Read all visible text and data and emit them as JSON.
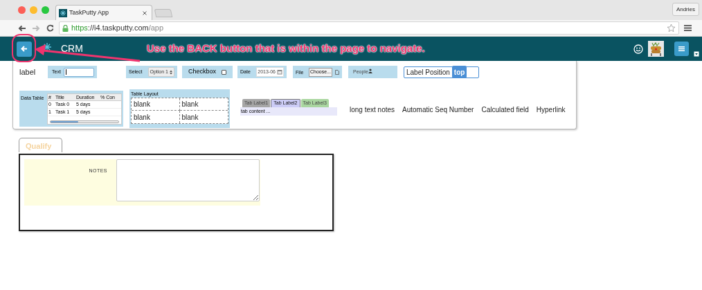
{
  "browser": {
    "tab_title": "TaskPutty App",
    "profile": "Andries",
    "url": {
      "scheme": "https",
      "host": "://i4.taskputty.com",
      "path": "/app"
    }
  },
  "header": {
    "title": "CRM"
  },
  "annotation": {
    "text": "Use the BACK button that is within the page to navigate."
  },
  "widgets": [
    {
      "kind": "label",
      "label": "label"
    },
    {
      "kind": "text",
      "label": "Text"
    },
    {
      "kind": "select",
      "label": "Select",
      "value": "Option 1"
    },
    {
      "kind": "checkbox",
      "label": "Checkbox",
      "checked": false
    },
    {
      "kind": "date",
      "label": "Date",
      "value": "2013-06"
    },
    {
      "kind": "file",
      "label": "File",
      "value": "Choose..."
    },
    {
      "kind": "people",
      "label": "People"
    },
    {
      "kind": "label_position",
      "label": "Label Position",
      "value": "top"
    }
  ],
  "data_table": {
    "title": "Data Table",
    "columns": [
      "#",
      "Title",
      "Duration",
      "% Con"
    ],
    "rows": [
      [
        "0",
        "Task 0",
        "5 days"
      ],
      [
        "1",
        "Task 1",
        "5 days"
      ]
    ]
  },
  "table_layout": {
    "title": "Table Layout",
    "cells": [
      [
        "blank",
        "blank"
      ],
      [
        "blank",
        "blank"
      ]
    ]
  },
  "tabs": {
    "items": [
      {
        "label": "Tab Label1",
        "selected": false,
        "color": "#a6a6a6"
      },
      {
        "label": "Tab Label2",
        "selected": true,
        "color": "#ccccf6"
      },
      {
        "label": "Tab Label3",
        "selected": false,
        "color": "#a9d6a0"
      }
    ],
    "content": "tab content ..."
  },
  "fields": [
    "long text notes",
    "Automatic Seq Number",
    "Calculated field",
    "Hyperlink"
  ],
  "section": {
    "tab": "Qualify",
    "notes_label": "NOTES"
  }
}
